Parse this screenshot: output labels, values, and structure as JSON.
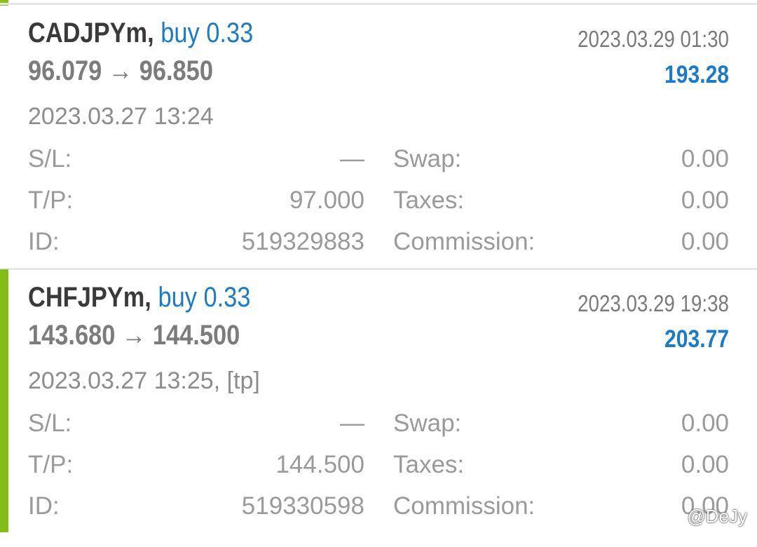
{
  "colors": {
    "accent_green": "#84bd16",
    "buy_blue": "#1a7cc9",
    "symbol_dark": "#3a3a3a",
    "muted_gray": "#9a9a9a",
    "divider": "#e6e6e6"
  },
  "trades": [
    {
      "symbol": "CADJPYm,",
      "direction": "buy 0.33",
      "prices": "96.079 → 96.850",
      "close_time": "2023.03.29 01:30",
      "profit": "193.28",
      "open_time": "2023.03.27 13:24",
      "sl_label": "S/L:",
      "sl_value": "—",
      "tp_label": "T/P:",
      "tp_value": "97.000",
      "id_label": "ID:",
      "id_value": "519329883",
      "swap_label": "Swap:",
      "swap_value": "0.00",
      "taxes_label": "Taxes:",
      "taxes_value": "0.00",
      "commission_label": "Commission:",
      "commission_value": "0.00"
    },
    {
      "symbol": "CHFJPYm,",
      "direction": "buy 0.33",
      "prices": "143.680 → 144.500",
      "close_time": "2023.03.29 19:38",
      "profit": "203.77",
      "open_time": "2023.03.27 13:25, [tp]",
      "sl_label": "S/L:",
      "sl_value": "—",
      "tp_label": "T/P:",
      "tp_value": "144.500",
      "id_label": "ID:",
      "id_value": "519330598",
      "swap_label": "Swap:",
      "swap_value": "0.00",
      "taxes_label": "Taxes:",
      "taxes_value": "0.00",
      "commission_label": "Commission:",
      "commission_value": "0.00"
    }
  ],
  "watermark": "@DeJy"
}
